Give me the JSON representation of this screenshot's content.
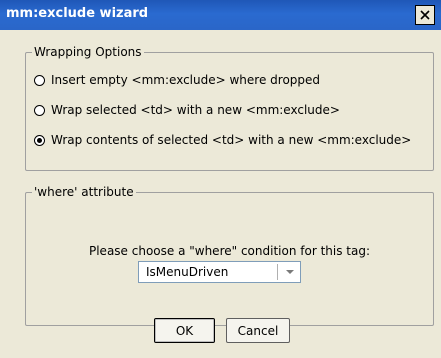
{
  "window": {
    "title": "mm:exclude wizard",
    "close_icon": "close-icon"
  },
  "wrapping_options": {
    "legend": "Wrapping Options",
    "options": [
      {
        "label": "Insert empty <mm:exclude> where dropped",
        "checked": false
      },
      {
        "label": "Wrap selected <td> with a new <mm:exclude>",
        "checked": false
      },
      {
        "label": "Wrap contents of selected <td> with a new <mm:exclude>",
        "checked": true
      }
    ]
  },
  "where_attribute": {
    "legend": "'where' attribute",
    "prompt": "Please choose a \"where\" condition for this tag:",
    "selected": "IsMenuDriven"
  },
  "buttons": {
    "ok": "OK",
    "cancel": "Cancel"
  },
  "colors": {
    "titlebar": "#2a66c8",
    "dialog_bg": "#ece9d8"
  }
}
